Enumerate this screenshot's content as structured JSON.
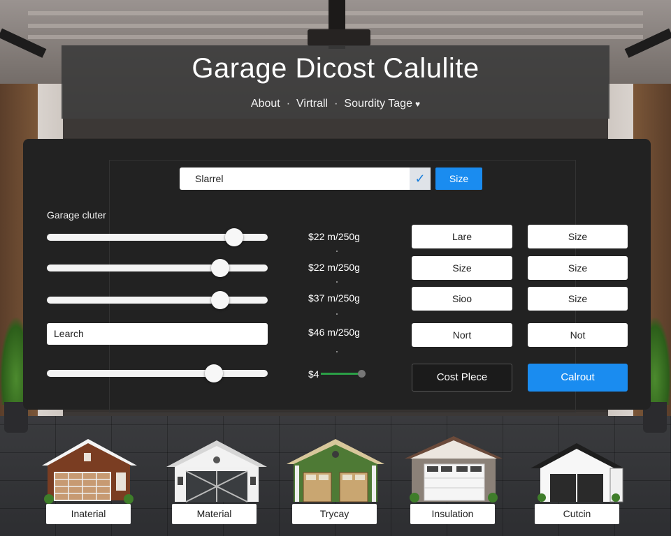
{
  "header": {
    "title": "Garage Dicost Calulite",
    "nav": [
      {
        "label": "About"
      },
      {
        "label": "Virtrall"
      },
      {
        "label": "Sourdity Tage"
      }
    ],
    "separator": "·"
  },
  "search": {
    "value": "Slarrel",
    "button_label": "Size"
  },
  "section_label": "Garage cluter",
  "sliders": [
    {
      "level_fraction": 0.88
    },
    {
      "level_fraction": 0.81
    },
    {
      "level_fraction": 0.81
    },
    {
      "level_fraction": 0.78
    }
  ],
  "lookup_field": {
    "value": "Learch"
  },
  "prices": [
    "$22 m/250g",
    "$22 m/250g",
    "$37 m/250g",
    "$46 m/250g",
    "$4"
  ],
  "options": {
    "left": [
      "Lare",
      "Size",
      "Sioo",
      "Nort"
    ],
    "right": [
      "Size",
      "Size",
      "Size",
      "Not"
    ]
  },
  "actions": {
    "cost_label": "Cost Plece",
    "calc_label": "Calrout"
  },
  "styles": [
    {
      "label": "Inaterial",
      "icon": "brown-garage-icon"
    },
    {
      "label": "Material",
      "icon": "white-garage-icon"
    },
    {
      "label": "Trycay",
      "icon": "green-garage-icon"
    },
    {
      "label": "Insulation",
      "icon": "grey-garage-icon"
    },
    {
      "label": "Cutcin",
      "icon": "black-roof-garage-icon"
    }
  ],
  "colors": {
    "accent": "#1a8cf0",
    "panel": "#222222",
    "progress_green": "#2b9f46"
  }
}
